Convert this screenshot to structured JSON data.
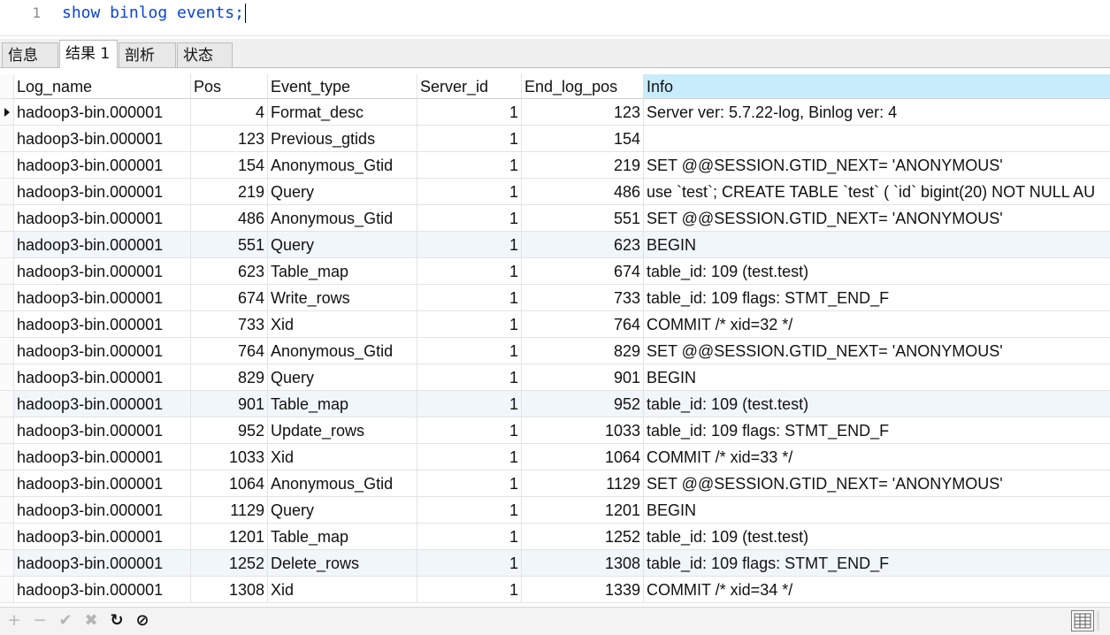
{
  "editor": {
    "line_number": "1",
    "query": "show binlog events;"
  },
  "tabs": [
    {
      "label": "信息"
    },
    {
      "label": "结果 1"
    },
    {
      "label": "剖析"
    },
    {
      "label": "状态"
    }
  ],
  "active_tab": "结果 1",
  "columns": [
    "Log_name",
    "Pos",
    "Event_type",
    "Server_id",
    "End_log_pos",
    "Info"
  ],
  "selected_column": "Info",
  "rows": [
    [
      "hadoop3-bin.000001",
      "4",
      "Format_desc",
      "1",
      "123",
      "Server ver: 5.7.22-log, Binlog ver: 4"
    ],
    [
      "hadoop3-bin.000001",
      "123",
      "Previous_gtids",
      "1",
      "154",
      ""
    ],
    [
      "hadoop3-bin.000001",
      "154",
      "Anonymous_Gtid",
      "1",
      "219",
      "SET @@SESSION.GTID_NEXT= 'ANONYMOUS'"
    ],
    [
      "hadoop3-bin.000001",
      "219",
      "Query",
      "1",
      "486",
      "use `test`; CREATE TABLE `test` (  `id` bigint(20) NOT NULL AU"
    ],
    [
      "hadoop3-bin.000001",
      "486",
      "Anonymous_Gtid",
      "1",
      "551",
      "SET @@SESSION.GTID_NEXT= 'ANONYMOUS'"
    ],
    [
      "hadoop3-bin.000001",
      "551",
      "Query",
      "1",
      "623",
      "BEGIN"
    ],
    [
      "hadoop3-bin.000001",
      "623",
      "Table_map",
      "1",
      "674",
      "table_id: 109 (test.test)"
    ],
    [
      "hadoop3-bin.000001",
      "674",
      "Write_rows",
      "1",
      "733",
      "table_id: 109 flags: STMT_END_F"
    ],
    [
      "hadoop3-bin.000001",
      "733",
      "Xid",
      "1",
      "764",
      "COMMIT /* xid=32 */"
    ],
    [
      "hadoop3-bin.000001",
      "764",
      "Anonymous_Gtid",
      "1",
      "829",
      "SET @@SESSION.GTID_NEXT= 'ANONYMOUS'"
    ],
    [
      "hadoop3-bin.000001",
      "829",
      "Query",
      "1",
      "901",
      "BEGIN"
    ],
    [
      "hadoop3-bin.000001",
      "901",
      "Table_map",
      "1",
      "952",
      "table_id: 109 (test.test)"
    ],
    [
      "hadoop3-bin.000001",
      "952",
      "Update_rows",
      "1",
      "1033",
      "table_id: 109 flags: STMT_END_F"
    ],
    [
      "hadoop3-bin.000001",
      "1033",
      "Xid",
      "1",
      "1064",
      "COMMIT /* xid=33 */"
    ],
    [
      "hadoop3-bin.000001",
      "1064",
      "Anonymous_Gtid",
      "1",
      "1129",
      "SET @@SESSION.GTID_NEXT= 'ANONYMOUS'"
    ],
    [
      "hadoop3-bin.000001",
      "1129",
      "Query",
      "1",
      "1201",
      "BEGIN"
    ],
    [
      "hadoop3-bin.000001",
      "1201",
      "Table_map",
      "1",
      "1252",
      "table_id: 109 (test.test)"
    ],
    [
      "hadoop3-bin.000001",
      "1252",
      "Delete_rows",
      "1",
      "1308",
      "table_id: 109 flags: STMT_END_F"
    ],
    [
      "hadoop3-bin.000001",
      "1308",
      "Xid",
      "1",
      "1339",
      "COMMIT /* xid=34 */"
    ]
  ],
  "current_row_index": 0,
  "toolbar": {
    "buttons": [
      {
        "icon": "plus-icon",
        "glyph": "+",
        "enabled": false
      },
      {
        "icon": "minus-icon",
        "glyph": "−",
        "enabled": false
      },
      {
        "icon": "check-icon",
        "glyph": "✔",
        "enabled": false
      },
      {
        "icon": "cross-icon",
        "glyph": "✖",
        "enabled": false
      },
      {
        "icon": "refresh-icon",
        "glyph": "↻",
        "enabled": true
      },
      {
        "icon": "stop-icon",
        "glyph": "⊘",
        "enabled": true
      }
    ],
    "view_icon": "grid-view-icon"
  },
  "colors": {
    "keyword": "#0a44d6",
    "header_selected": "#c9ecfb",
    "row_alt": "#f1f6fb"
  }
}
